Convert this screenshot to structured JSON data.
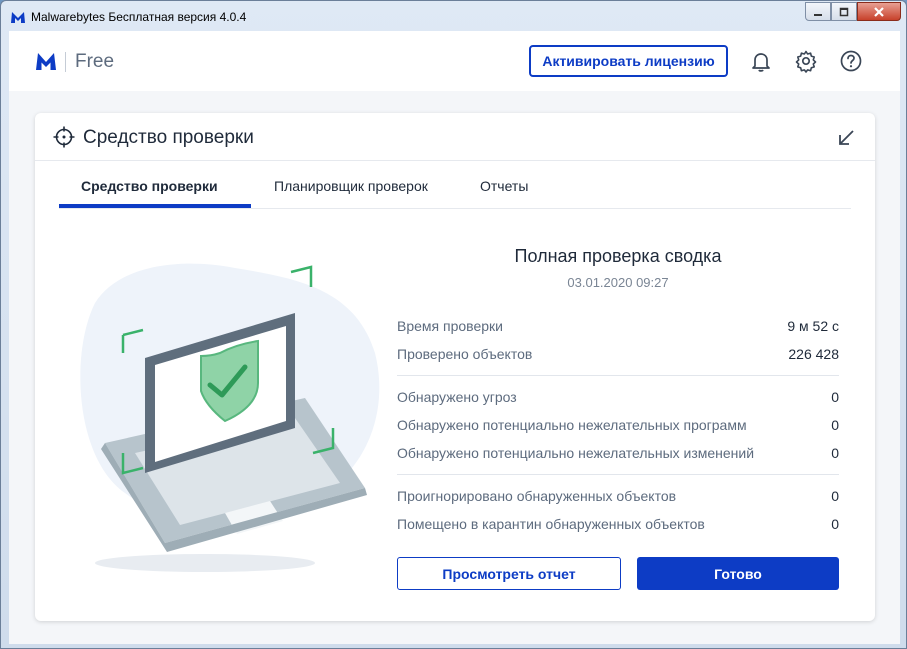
{
  "window": {
    "title": "Malwarebytes Бесплатная версия  4.0.4"
  },
  "header": {
    "edition": "Free",
    "activate_label": "Активировать лицензию",
    "icons": [
      "bell-icon",
      "gear-icon",
      "help-icon"
    ]
  },
  "card": {
    "title": "Средство проверки",
    "tabs": [
      {
        "label": "Средство проверки",
        "active": true
      },
      {
        "label": "Планировщик проверок",
        "active": false
      },
      {
        "label": "Отчеты",
        "active": false
      }
    ]
  },
  "summary": {
    "title": "Полная проверка сводка",
    "date": "03.01.2020 09:27",
    "group1": [
      {
        "label": "Время проверки",
        "value": "9 м 52 с"
      },
      {
        "label": "Проверено объектов",
        "value": "226 428"
      }
    ],
    "group2": [
      {
        "label": "Обнаружено угроз",
        "value": "0"
      },
      {
        "label": "Обнаружено потенциально нежелательных программ",
        "value": "0"
      },
      {
        "label": "Обнаружено потенциально нежелательных изменений",
        "value": "0"
      }
    ],
    "group3": [
      {
        "label": "Проигнорировано обнаруженных объектов",
        "value": "0"
      },
      {
        "label": "Помещено в карантин обнаруженных объектов",
        "value": "0"
      }
    ]
  },
  "actions": {
    "view_report": "Просмотреть отчет",
    "done": "Готово"
  },
  "colors": {
    "accent": "#0d3cc5",
    "shield_green": "#3ab26a"
  }
}
